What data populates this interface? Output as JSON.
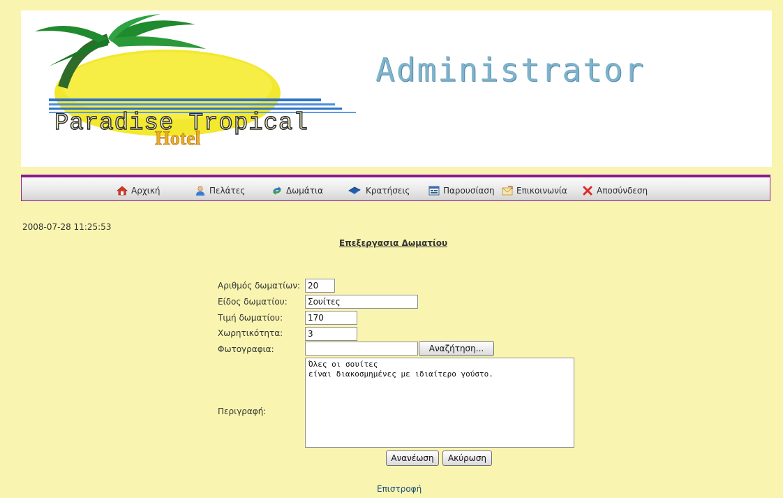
{
  "banner": {
    "admin_title": "Administrator",
    "hotel_name": "Paradise Tropical",
    "hotel_word": "Hotel"
  },
  "nav": {
    "items": [
      {
        "label": "Αρχική",
        "icon": "home-icon"
      },
      {
        "label": "Πελάτες",
        "icon": "user-icon"
      },
      {
        "label": "Δωμάτια",
        "icon": "rooms-icon"
      },
      {
        "label": "Κρατήσεις",
        "icon": "book-icon"
      },
      {
        "label": "Παρουσίαση",
        "icon": "presentation-icon"
      },
      {
        "label": "Επικοινωνία",
        "icon": "mail-icon"
      },
      {
        "label": "Αποσύνδεση",
        "icon": "close-icon"
      }
    ]
  },
  "timestamp": "2008-07-28 11:25:53",
  "page_title": "Επεξεργασια Δωματίου",
  "form": {
    "room_count_label": "Αριθμός δωματίων:",
    "room_count_value": "20",
    "room_type_label": "Είδος δωματίου:",
    "room_type_value": "Σουίτες",
    "room_price_label": "Τιμή δωματίου:",
    "room_price_value": "170",
    "capacity_label": "Χωρητικότητα:",
    "capacity_value": "3",
    "photo_label": "Φωτογραφια:",
    "photo_value": "",
    "browse_label": "Αναζήτηση...",
    "description_label": "Περιγραφή:",
    "description_value": "Όλες οι σουίτες\nείναι διακοσμημένες με ιδιαίτερο γούστο.",
    "update_label": "Ανανέωση",
    "cancel_label": "Ακύρωση"
  },
  "back_link": "Επιστροφή",
  "colors": {
    "page_bg": "#f9f5b1",
    "nav_border": "#8b1a8c",
    "admin_title": "#7fb3cc"
  }
}
